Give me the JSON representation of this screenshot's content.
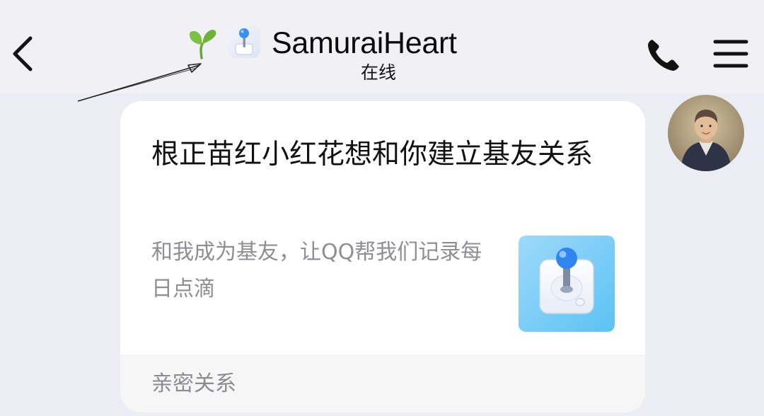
{
  "header": {
    "contact_name": "SamuraiHeart",
    "status": "在线",
    "badges": [
      "sprout-icon",
      "joystick-icon"
    ],
    "actions": [
      "back-icon",
      "phone-icon",
      "menu-icon"
    ]
  },
  "message_card": {
    "title": "根正苗红小红花想和你建立基友关系",
    "description": "和我成为基友，让QQ帮我们记录每日点滴",
    "thumbnail_icon": "joystick-icon",
    "footer_label": "亲密关系"
  },
  "colors": {
    "background": "#ececf5",
    "header_background": "#f1f1f5",
    "card_background": "#ffffff",
    "accent_blue": "#3a8ef0",
    "sprout_green": "#7cc242"
  }
}
